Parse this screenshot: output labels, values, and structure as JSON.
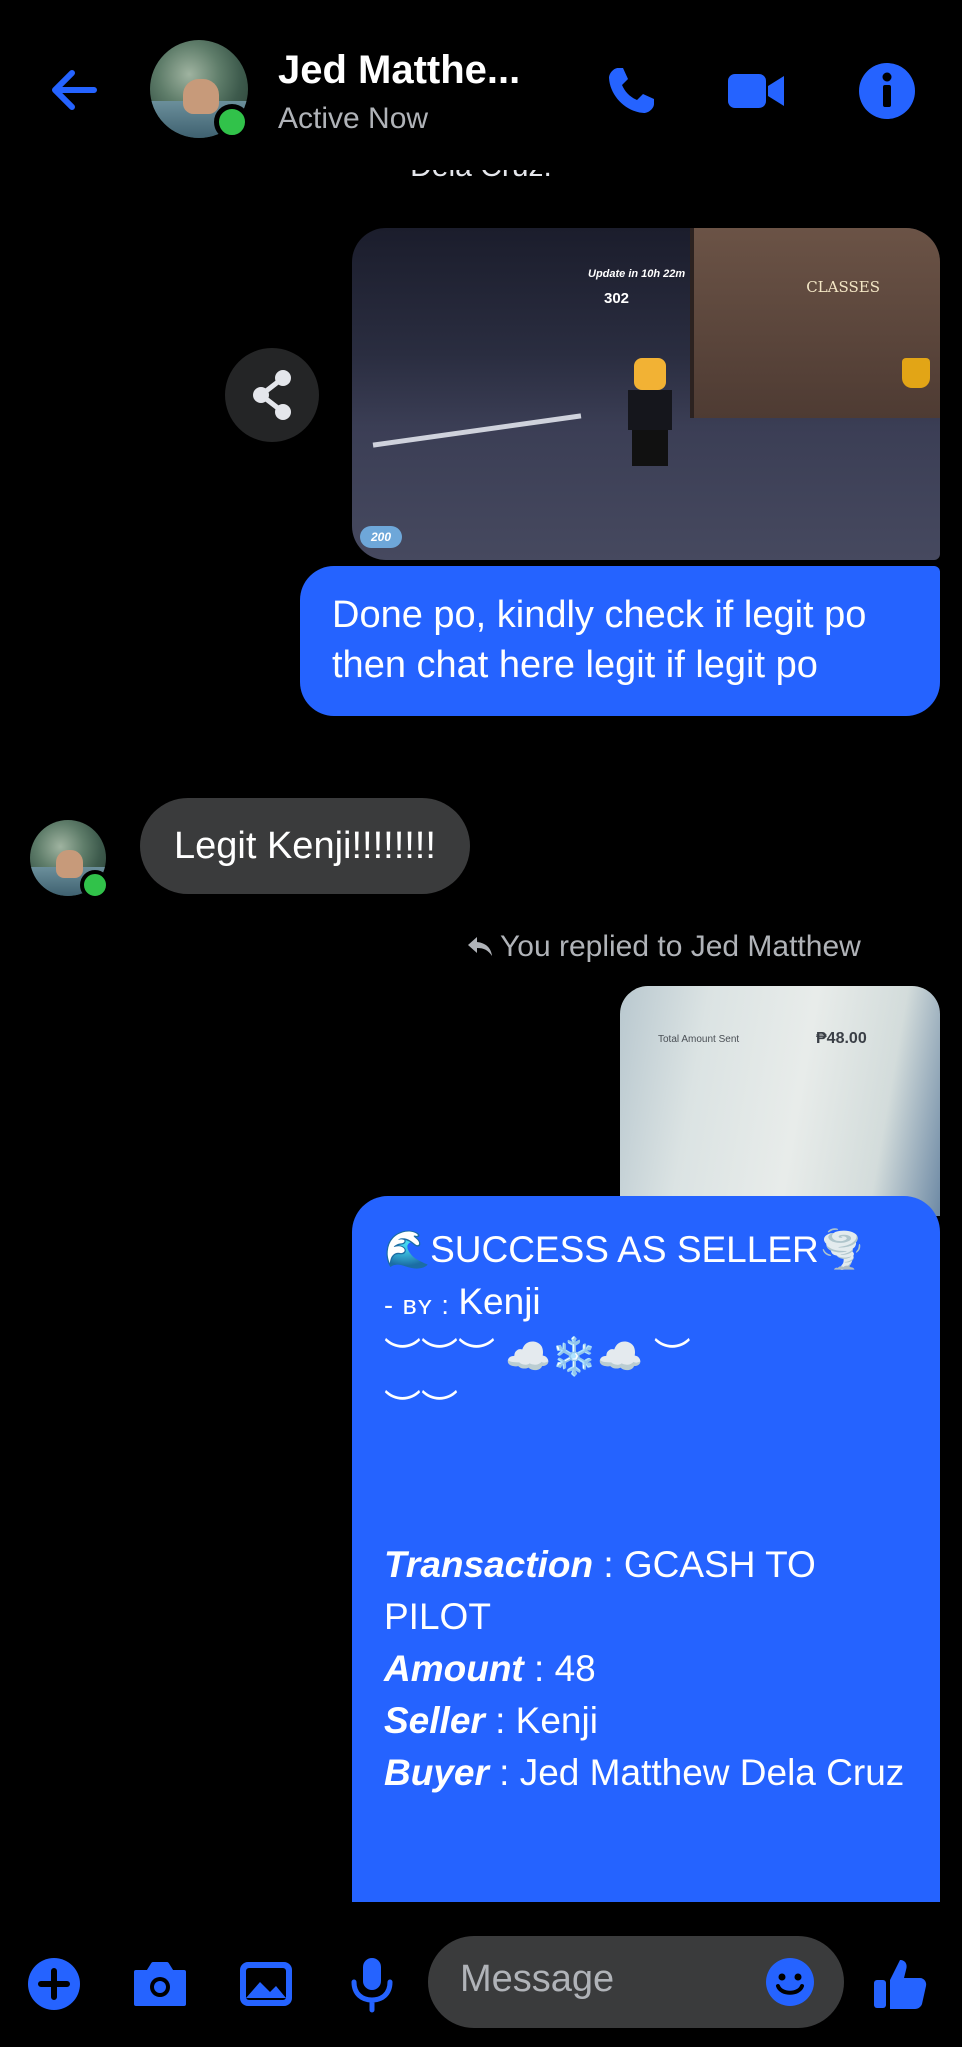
{
  "header": {
    "contact_name": "Jed Matthe...",
    "status": "Active Now",
    "accent_color": "#2563ff",
    "icons": [
      "back-arrow-icon",
      "phone-icon",
      "video-call-icon",
      "info-icon"
    ]
  },
  "partial_above_text": "Dela Cruz.",
  "image_attachment": {
    "update_text": "Update in 10h 22m",
    "counter": "302",
    "sign_text": "CLASSES",
    "gems_text": "200"
  },
  "messages": {
    "msg1": "Done po, kindly check if legit po then chat here legit if legit po",
    "msg2": "Legit Kenji!!!!!!!!",
    "reply_note": "You replied to Jed Matthew",
    "receipt_label": "Total Amount Sent",
    "receipt_value": "₱48.00",
    "seller_post": {
      "title_line": "🌊SUCCESS AS SELLER🌪️",
      "by_prefix": "- ʙʏ : ",
      "by_name": "Kenji",
      "deco1": "︶︶︶ ☁️❄️☁️ ︶",
      "deco2": "︶︶",
      "transaction_label": "Transaction",
      "transaction_value": " : GCASH TO PILOT",
      "amount_label": "Amount",
      "amount_value": " : 48",
      "seller_label": "Seller",
      "seller_value": " : Kenji",
      "buyer_label": "Buyer",
      "buyer_value": " : Jed Matthew Dela Cruz"
    }
  },
  "composer": {
    "placeholder": "Message",
    "icons": [
      "plus-icon",
      "camera-icon",
      "gallery-icon",
      "microphone-icon",
      "emoji-icon",
      "like-icon"
    ]
  }
}
